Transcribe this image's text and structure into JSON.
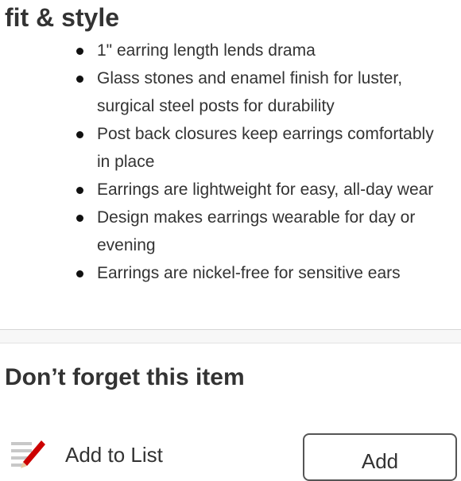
{
  "details": {
    "title": "fit & style",
    "bullets": [
      "1\" earring length lends drama",
      "Glass stones and enamel finish for luster, surgical steel posts for durability",
      "Post back closures keep earrings comfortably in place",
      "Earrings are lightweight for easy, all-day wear",
      "Design makes earrings wearable for day or evening",
      "Earrings are nickel-free for sensitive ears"
    ]
  },
  "recommendation": {
    "title": "Don’t forget this item",
    "add_to_list_label": "Add to List",
    "add_button_label": "Add",
    "icon": "list-pencil-icon"
  },
  "colors": {
    "text": "#333333",
    "pencil_red": "#cc0000",
    "divider": "#f7f7f7"
  }
}
